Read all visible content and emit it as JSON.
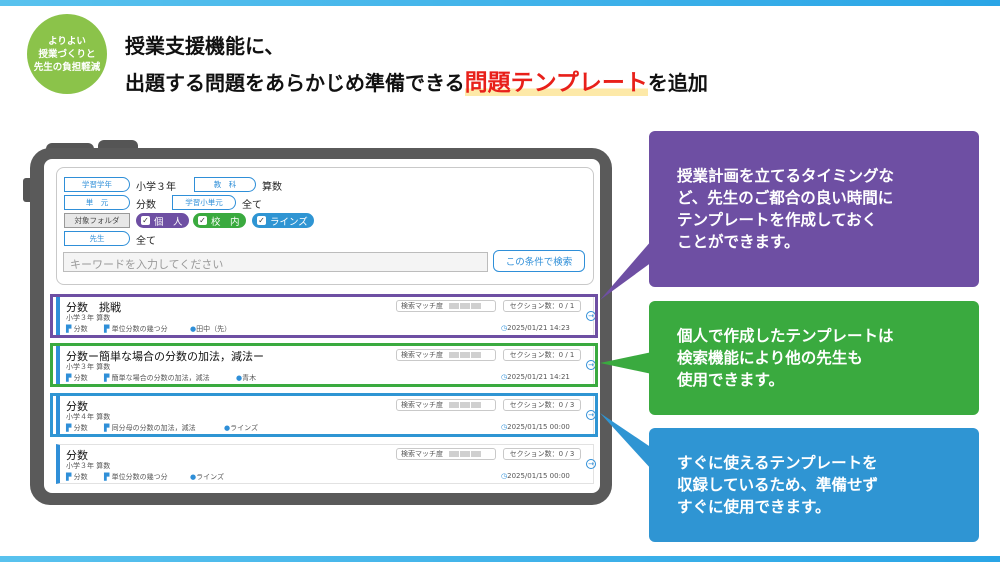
{
  "badge": {
    "line1": "よりよい",
    "line2": "授業づくりと",
    "line3": "先生の負担軽減"
  },
  "title": {
    "line1": "授業支援機能に、",
    "line2_pre": "出題する問題をあらかじめ準備できる",
    "line2_highlight": "問題テンプレート",
    "line2_post": "を追加"
  },
  "colors": {
    "purple": "#6e4fa3",
    "green": "#3aaa3f",
    "blue": "#2f95d3",
    "accent_red": "#e8201a"
  },
  "search": {
    "grade_label": "学習学年",
    "grade_value": "小学３年",
    "subject_label": "教　科",
    "subject_value": "算数",
    "unit_label": "単　元",
    "unit_value": "分数",
    "subunit_label": "学習小単元",
    "subunit_value": "全て",
    "folder_label": "対象フォルダ",
    "folders": [
      "個　人",
      "校　内",
      "ラインズ"
    ],
    "teacher_label": "先生",
    "teacher_value": "全て",
    "keyword_placeholder": "キーワードを入力してください",
    "search_button": "この条件で検索"
  },
  "results": [
    {
      "title": "分数　挑戦",
      "grade": "小学３年 算数",
      "tag1": "分数",
      "tag2": "単位分数の幾つ分",
      "author": "田中（先）",
      "match": "検索マッチ度",
      "sections": "セクション数：0 / 1",
      "date": "2025/01/21 14:23"
    },
    {
      "title": "分数ー簡単な場合の分数の加法，減法ー",
      "grade": "小学３年 算数",
      "tag1": "分数",
      "tag2": "簡単な場合の分数の加法，減法",
      "author": "青木",
      "match": "検索マッチ度",
      "sections": "セクション数：0 / 1",
      "date": "2025/01/21 14:21"
    },
    {
      "title": "分数",
      "grade": "小学４年 算数",
      "tag1": "分数",
      "tag2": "同分母の分数の加法，減法",
      "author": "ラインズ",
      "match": "検索マッチ度",
      "sections": "セクション数：0 / 3",
      "date": "2025/01/15 00:00"
    },
    {
      "title": "分数",
      "grade": "小学３年 算数",
      "tag1": "分数",
      "tag2": "単位分数の幾つ分",
      "author": "ラインズ",
      "match": "検索マッチ度",
      "sections": "セクション数：0 / 3",
      "date": "2025/01/15 00:00"
    }
  ],
  "callouts": [
    "授業計画を立てるタイミングな\nど、先生のご都合の良い時間に\nテンプレートを作成しておく\nことができます。",
    "個人で作成したテンプレートは\n検索機能により他の先生も\n使用できます。",
    "すぐに使えるテンプレートを\n収録しているため、準備せず\nすぐに使用できます。"
  ]
}
